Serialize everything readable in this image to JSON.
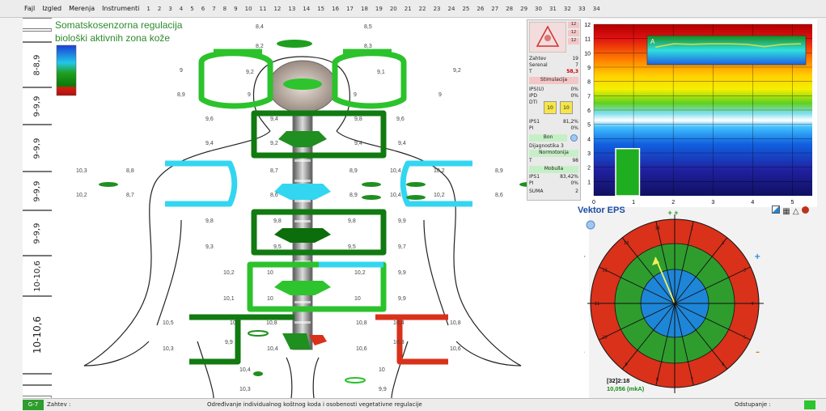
{
  "menu": {
    "items": [
      "Fajl",
      "Izgled",
      "Merenja",
      "Instrumenti"
    ],
    "tabs": [
      "1",
      "2",
      "3",
      "4",
      "5",
      "6",
      "7",
      "8",
      "9",
      "10",
      "11",
      "12",
      "13",
      "14",
      "15",
      "16",
      "17",
      "18",
      "19",
      "20",
      "21",
      "22",
      "23",
      "24",
      "25",
      "26",
      "27",
      "28",
      "29",
      "30",
      "31",
      "32",
      "33",
      "34"
    ]
  },
  "left_scale": [
    "8-8,9",
    "9-9,9",
    "9-9,9",
    "9-9,9",
    "9-9,9",
    "10-10,6",
    "10-10,6"
  ],
  "body": {
    "title_line1": "Somatskosenzorna regulacija",
    "title_line2": "biološki aktivnih zona kože",
    "zone_values": [
      {
        "t": "8,4"
      },
      {
        "t": "8,5"
      },
      {
        "t": "8,2"
      },
      {
        "t": "8,3"
      },
      {
        "t": "9"
      },
      {
        "t": "9,2"
      },
      {
        "t": "9,1"
      },
      {
        "t": "9,2"
      },
      {
        "t": "8,9"
      },
      {
        "t": "9"
      },
      {
        "t": "9"
      },
      {
        "t": "9"
      },
      {
        "t": "9,6"
      },
      {
        "t": "9,4"
      },
      {
        "t": "9,8"
      },
      {
        "t": "9,6"
      },
      {
        "t": "9,4"
      },
      {
        "t": "9,2"
      },
      {
        "t": "9,4"
      },
      {
        "t": "9,4"
      },
      {
        "t": "10,3"
      },
      {
        "t": "8,8"
      },
      {
        "t": "8,7"
      },
      {
        "t": "8,9"
      },
      {
        "t": "10,4"
      },
      {
        "t": "10,2"
      },
      {
        "t": "8,9"
      },
      {
        "t": "10,2"
      },
      {
        "t": "8,7"
      },
      {
        "t": "8,6"
      },
      {
        "t": "8,9"
      },
      {
        "t": "10,4"
      },
      {
        "t": "10,2"
      },
      {
        "t": "8,6"
      },
      {
        "t": "9,8"
      },
      {
        "t": "9,8"
      },
      {
        "t": "9,8"
      },
      {
        "t": "9,9"
      },
      {
        "t": "9,3"
      },
      {
        "t": "9,5"
      },
      {
        "t": "9,5"
      },
      {
        "t": "9,7"
      },
      {
        "t": "10,2"
      },
      {
        "t": "10"
      },
      {
        "t": "10,2"
      },
      {
        "t": "9,9"
      },
      {
        "t": "10,1"
      },
      {
        "t": "10"
      },
      {
        "t": "10"
      },
      {
        "t": "9,9"
      },
      {
        "t": "10,5"
      },
      {
        "t": "10"
      },
      {
        "t": "10,8"
      },
      {
        "t": "10,8"
      },
      {
        "t": "10,4"
      },
      {
        "t": "10,8"
      },
      {
        "t": "9,9"
      },
      {
        "t": "10,3"
      },
      {
        "t": "10,4"
      },
      {
        "t": "10,6"
      },
      {
        "t": "10,3"
      },
      {
        "t": "10,6"
      },
      {
        "t": "10,4"
      },
      {
        "t": "10"
      },
      {
        "t": "10,3"
      },
      {
        "t": "9,9"
      }
    ]
  },
  "info": {
    "zahtev_label": "Zahtev",
    "zahtev_val": "19",
    "serenal_label": "Serenal",
    "serenal_val": "7",
    "t_label": "T",
    "t_val": "58,3",
    "stimulacija": "Stimulacija",
    "ipso_label": "IPS(U)",
    "ipso_val": "0%",
    "ipd_label": "IPD",
    "ipd_val": "0%",
    "dti_label": "DTI",
    "dti_box1": "10",
    "dti_box2": "10",
    "ips1_label": "IPS1",
    "ips1_val": "81,2%",
    "pi_label": "PI",
    "pi_val": "0%",
    "bon": "Bon",
    "diagnostika": "Dijagnostika 3",
    "normotonija": "Normotonija",
    "t2_val": "98",
    "mobulla": "Mobulla",
    "ips2_label": "IPS1",
    "ips2_val": "83,42%",
    "pi2_label": "PI",
    "pi2_val": "0%",
    "suma_label": "SUMA",
    "suma_val": "2"
  },
  "chart_data": {
    "type": "bar",
    "categories": [
      "1"
    ],
    "values": [
      3.3
    ],
    "xlim": [
      0,
      5.5
    ],
    "ylim": [
      0,
      12
    ],
    "xticks": [
      0,
      1,
      2,
      3,
      4,
      5
    ],
    "yticks": [
      1,
      2,
      3,
      4,
      5,
      6,
      7,
      8,
      9,
      10,
      11,
      12
    ],
    "inset_label": "A",
    "inset_line": [
      0.6,
      0.72,
      0.7,
      0.72,
      0.72,
      0.7,
      0.62,
      0.7,
      0.72
    ]
  },
  "eps": {
    "title": "Vektor EPS",
    "top_mark": "+ +",
    "readout1": "[32]2:18",
    "readout2": "10,056 (mkA)",
    "numbers": [
      "1",
      "2",
      "3",
      "4",
      "5",
      "6",
      "7",
      "8",
      "9",
      "10",
      "11",
      "12",
      "13",
      "14"
    ]
  },
  "status": {
    "code": "G-7",
    "zahtev": "Zahtev :",
    "description": "Određivanje individualnog koštnog koda i osobenosti vegetativne regulacije",
    "odstupanje": "Odstupanje :"
  },
  "colors": {
    "green": "#2e9d2e",
    "cyan": "#33d6f0",
    "red": "#d9311a",
    "blue": "#1e86d8"
  }
}
